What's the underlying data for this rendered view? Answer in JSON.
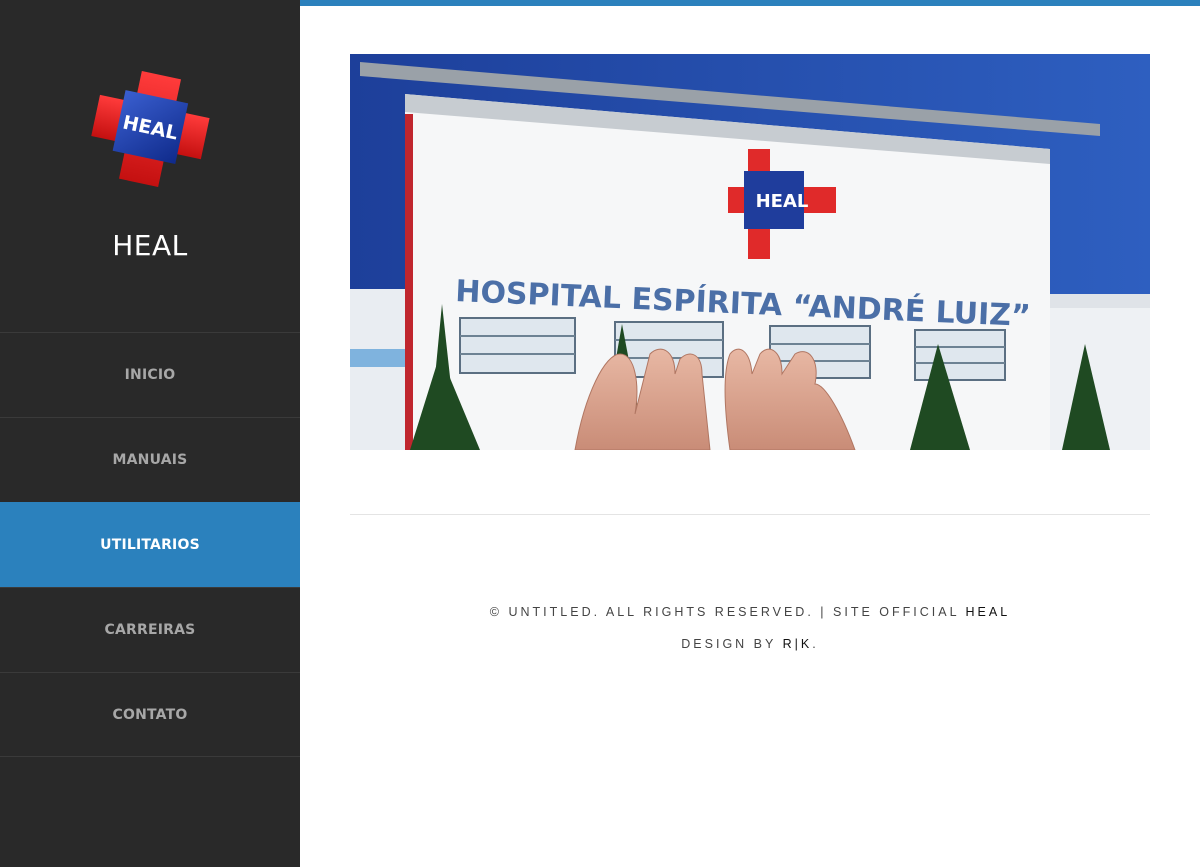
{
  "sidebar": {
    "logo_text": "HEAL",
    "site_title": "HEAL",
    "nav": [
      {
        "label": "INICIO",
        "active": false
      },
      {
        "label": "MANUAIS",
        "active": false
      },
      {
        "label": "UTILITARIOS",
        "active": true
      },
      {
        "label": "CARREIRAS",
        "active": false
      },
      {
        "label": "CONTATO",
        "active": false
      }
    ]
  },
  "banner": {
    "building_sign": "HOSPITAL  ESPÍRITA “ANDRÉ  LUIZ”",
    "logo_text": "HEAL"
  },
  "footer": {
    "copyright": "© UNTITLED. ALL RIGHTS RESERVED. | SITE OFFICIAL ",
    "site_link": "HEAL",
    "design_prefix": "DESIGN BY ",
    "designer_link": "R|K",
    "design_suffix": "."
  },
  "colors": {
    "accent": "#2b81bd",
    "sidebar_bg": "#292929",
    "nav_text": "#a7a7a7"
  }
}
